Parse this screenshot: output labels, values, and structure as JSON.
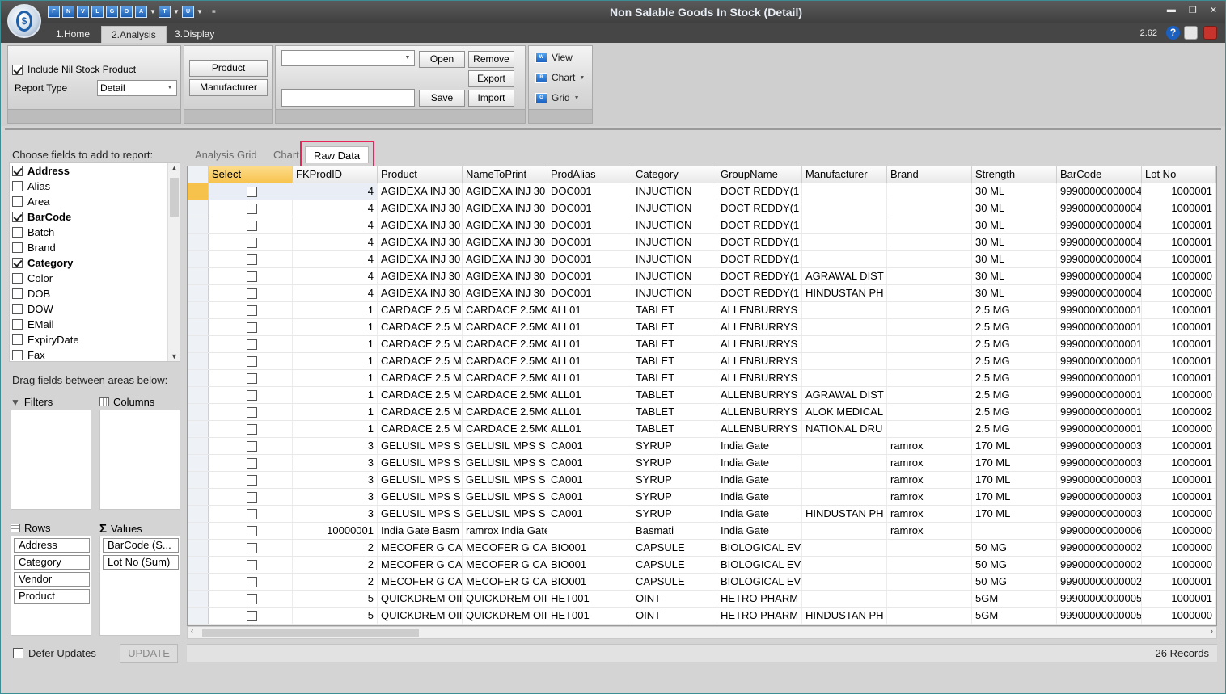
{
  "window": {
    "title": "Non Salable Goods In Stock (Detail)",
    "version": "2.62"
  },
  "colors": {
    "accent": "#e8245a",
    "selected_header": "#f7c24c",
    "titlebar": "#464646"
  },
  "quick_access": [
    "F",
    "N",
    "V",
    "L",
    "G",
    "O",
    "A",
    "T",
    "U"
  ],
  "ribbon_tabs": [
    "1.Home",
    "2.Analysis",
    "3.Display"
  ],
  "ribbon": {
    "include_nil_label": "Include Nil Stock Product",
    "report_type_label": "Report Type",
    "report_type_value": "Detail",
    "product_btn": "Product",
    "manufacturer_btn": "Manufacturer",
    "open_btn": "Open",
    "remove_btn": "Remove",
    "export_btn": "Export",
    "save_btn": "Save",
    "import_btn": "Import",
    "view_btn": "View",
    "chart_btn": "Chart",
    "grid_btn": "Grid"
  },
  "left": {
    "choose_label": "Choose fields to add to report:",
    "fields": [
      {
        "name": "Address",
        "checked": true
      },
      {
        "name": "Alias",
        "checked": false
      },
      {
        "name": "Area",
        "checked": false
      },
      {
        "name": "BarCode",
        "checked": true
      },
      {
        "name": "Batch",
        "checked": false
      },
      {
        "name": "Brand",
        "checked": false
      },
      {
        "name": "Category",
        "checked": true
      },
      {
        "name": "Color",
        "checked": false
      },
      {
        "name": "DOB",
        "checked": false
      },
      {
        "name": "DOW",
        "checked": false
      },
      {
        "name": "EMail",
        "checked": false
      },
      {
        "name": "ExpiryDate",
        "checked": false
      },
      {
        "name": "Fax",
        "checked": false
      }
    ],
    "drag_label": "Drag fields between areas below:",
    "filters_label": "Filters",
    "columns_label": "Columns",
    "rows_label": "Rows",
    "values_label": "Values",
    "rows_fields": [
      "Address",
      "Category",
      "Vendor",
      "Product"
    ],
    "values_fields": [
      "BarCode (S...",
      "Lot No (Sum)"
    ],
    "defer_label": "Defer Updates",
    "update_btn": "UPDATE"
  },
  "inner_tabs": [
    "Analysis Grid",
    "Chart",
    "Raw Data"
  ],
  "grid": {
    "columns": [
      "Select",
      "FKProdID",
      "Product",
      "NameToPrint",
      "ProdAlias",
      "Category",
      "GroupName",
      "Manufacturer",
      "Brand",
      "Strength",
      "BarCode",
      "Lot No"
    ],
    "rows": [
      [
        "4",
        "AGIDEXA INJ 30",
        "AGIDEXA INJ 30",
        "DOC001",
        "INJUCTION",
        "DOCT REDDY(1",
        "",
        "",
        "30 ML",
        "99900000000004",
        "1000001"
      ],
      [
        "4",
        "AGIDEXA INJ 30",
        "AGIDEXA INJ 30",
        "DOC001",
        "INJUCTION",
        "DOCT REDDY(1",
        "",
        "",
        "30 ML",
        "99900000000004",
        "1000001"
      ],
      [
        "4",
        "AGIDEXA INJ 30",
        "AGIDEXA INJ 30",
        "DOC001",
        "INJUCTION",
        "DOCT REDDY(1",
        "",
        "",
        "30 ML",
        "99900000000004",
        "1000001"
      ],
      [
        "4",
        "AGIDEXA INJ 30",
        "AGIDEXA INJ 30",
        "DOC001",
        "INJUCTION",
        "DOCT REDDY(1",
        "",
        "",
        "30 ML",
        "99900000000004",
        "1000001"
      ],
      [
        "4",
        "AGIDEXA INJ 30",
        "AGIDEXA INJ 30",
        "DOC001",
        "INJUCTION",
        "DOCT REDDY(1",
        "",
        "",
        "30 ML",
        "99900000000004",
        "1000001"
      ],
      [
        "4",
        "AGIDEXA INJ 30",
        "AGIDEXA INJ 30",
        "DOC001",
        "INJUCTION",
        "DOCT REDDY(1",
        "AGRAWAL DIST",
        "",
        "30 ML",
        "99900000000004",
        "1000000"
      ],
      [
        "4",
        "AGIDEXA INJ 30",
        "AGIDEXA INJ 30",
        "DOC001",
        "INJUCTION",
        "DOCT REDDY(1",
        "HINDUSTAN PH",
        "",
        "30 ML",
        "99900000000004",
        "1000000"
      ],
      [
        "1",
        "CARDACE 2.5 M",
        "CARDACE 2.5MG",
        "ALL01",
        "TABLET",
        "ALLENBURRYS",
        "",
        "",
        "2.5 MG",
        "99900000000001",
        "1000001"
      ],
      [
        "1",
        "CARDACE 2.5 M",
        "CARDACE 2.5MG",
        "ALL01",
        "TABLET",
        "ALLENBURRYS",
        "",
        "",
        "2.5 MG",
        "99900000000001",
        "1000001"
      ],
      [
        "1",
        "CARDACE 2.5 M",
        "CARDACE 2.5MG",
        "ALL01",
        "TABLET",
        "ALLENBURRYS",
        "",
        "",
        "2.5 MG",
        "99900000000001",
        "1000001"
      ],
      [
        "1",
        "CARDACE 2.5 M",
        "CARDACE 2.5MG",
        "ALL01",
        "TABLET",
        "ALLENBURRYS",
        "",
        "",
        "2.5 MG",
        "99900000000001",
        "1000001"
      ],
      [
        "1",
        "CARDACE 2.5 M",
        "CARDACE 2.5MG",
        "ALL01",
        "TABLET",
        "ALLENBURRYS",
        "",
        "",
        "2.5 MG",
        "99900000000001",
        "1000001"
      ],
      [
        "1",
        "CARDACE 2.5 M",
        "CARDACE 2.5MG",
        "ALL01",
        "TABLET",
        "ALLENBURRYS",
        "AGRAWAL DIST",
        "",
        "2.5 MG",
        "99900000000001",
        "1000000"
      ],
      [
        "1",
        "CARDACE 2.5 M",
        "CARDACE 2.5MG",
        "ALL01",
        "TABLET",
        "ALLENBURRYS",
        "ALOK MEDICAL",
        "",
        "2.5 MG",
        "99900000000001",
        "1000002"
      ],
      [
        "1",
        "CARDACE 2.5 M",
        "CARDACE 2.5MG",
        "ALL01",
        "TABLET",
        "ALLENBURRYS",
        "NATIONAL DRU",
        "",
        "2.5 MG",
        "99900000000001",
        "1000000"
      ],
      [
        "3",
        "GELUSIL MPS S",
        "GELUSIL MPS S",
        "CA001",
        "SYRUP",
        "India Gate",
        "",
        "ramrox",
        "170 ML",
        "99900000000003",
        "1000001"
      ],
      [
        "3",
        "GELUSIL MPS S",
        "GELUSIL MPS S",
        "CA001",
        "SYRUP",
        "India Gate",
        "",
        "ramrox",
        "170 ML",
        "99900000000003",
        "1000001"
      ],
      [
        "3",
        "GELUSIL MPS S",
        "GELUSIL MPS S",
        "CA001",
        "SYRUP",
        "India Gate",
        "",
        "ramrox",
        "170 ML",
        "99900000000003",
        "1000001"
      ],
      [
        "3",
        "GELUSIL MPS S",
        "GELUSIL MPS S",
        "CA001",
        "SYRUP",
        "India Gate",
        "",
        "ramrox",
        "170 ML",
        "99900000000003",
        "1000001"
      ],
      [
        "3",
        "GELUSIL MPS S",
        "GELUSIL MPS S",
        "CA001",
        "SYRUP",
        "India Gate",
        "HINDUSTAN PH",
        "ramrox",
        "170 ML",
        "99900000000003",
        "1000000"
      ],
      [
        "10000001",
        "India Gate Basm",
        "ramrox India Gate",
        "",
        "Basmati",
        "India Gate",
        "",
        "ramrox",
        "",
        "99900000000006",
        "1000000"
      ],
      [
        "2",
        "MECOFER G CA",
        "MECOFER G CA",
        "BIO001",
        "CAPSULE",
        "BIOLOGICAL EV.",
        "",
        "",
        "50 MG",
        "99900000000002",
        "1000000"
      ],
      [
        "2",
        "MECOFER G CA",
        "MECOFER G CA",
        "BIO001",
        "CAPSULE",
        "BIOLOGICAL EV.",
        "",
        "",
        "50 MG",
        "99900000000002",
        "1000000"
      ],
      [
        "2",
        "MECOFER G CA",
        "MECOFER G CA",
        "BIO001",
        "CAPSULE",
        "BIOLOGICAL EV.",
        "",
        "",
        "50 MG",
        "99900000000002",
        "1000001"
      ],
      [
        "5",
        "QUICKDREM OII",
        "QUICKDREM OII",
        "HET001",
        "OINT",
        "HETRO PHARM",
        "",
        "",
        "5GM",
        "99900000000005",
        "1000001"
      ],
      [
        "5",
        "QUICKDREM OII",
        "QUICKDREM OII",
        "HET001",
        "OINT",
        "HETRO PHARM",
        "HINDUSTAN PH",
        "",
        "5GM",
        "99900000000005",
        "1000000"
      ]
    ]
  },
  "status": {
    "records": "26 Records"
  }
}
